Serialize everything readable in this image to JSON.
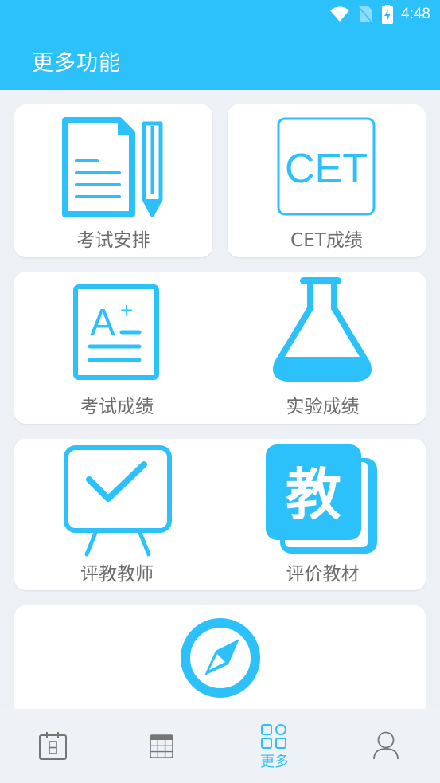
{
  "status_bar": {
    "time": "4:48",
    "icons": [
      "wifi-icon",
      "no-sim-icon",
      "battery-charging-icon"
    ]
  },
  "header": {
    "title": "更多功能"
  },
  "colors": {
    "accent": "#2DC1FC",
    "background": "#EDF1F5",
    "label": "#6C6C6C",
    "nav_inactive": "#767676"
  },
  "features": [
    {
      "id": "exam-schedule",
      "label": "考试安排",
      "icon": "document-pencil-icon"
    },
    {
      "id": "cet-score",
      "label": "CET成绩",
      "icon": "cet-icon",
      "icon_text": "CET"
    },
    {
      "id": "exam-score",
      "label": "考试成绩",
      "icon": "grade-sheet-icon",
      "icon_text": "A",
      "icon_sup": "+"
    },
    {
      "id": "lab-score",
      "label": "实验成绩",
      "icon": "flask-icon"
    },
    {
      "id": "evaluate-teacher",
      "label": "评教教师",
      "icon": "easel-check-icon"
    },
    {
      "id": "evaluate-textbook",
      "label": "评价教材",
      "icon": "textbook-icon",
      "icon_text": "教"
    },
    {
      "id": "explore",
      "label": "",
      "icon": "compass-icon"
    }
  ],
  "bottom_nav": [
    {
      "id": "today",
      "label": "",
      "icon": "calendar-day-icon",
      "active": false
    },
    {
      "id": "timetable",
      "label": "",
      "icon": "timetable-grid-icon",
      "active": false
    },
    {
      "id": "more",
      "label": "更多",
      "icon": "grid-more-icon",
      "active": true
    },
    {
      "id": "profile",
      "label": "",
      "icon": "person-icon",
      "active": false
    }
  ]
}
